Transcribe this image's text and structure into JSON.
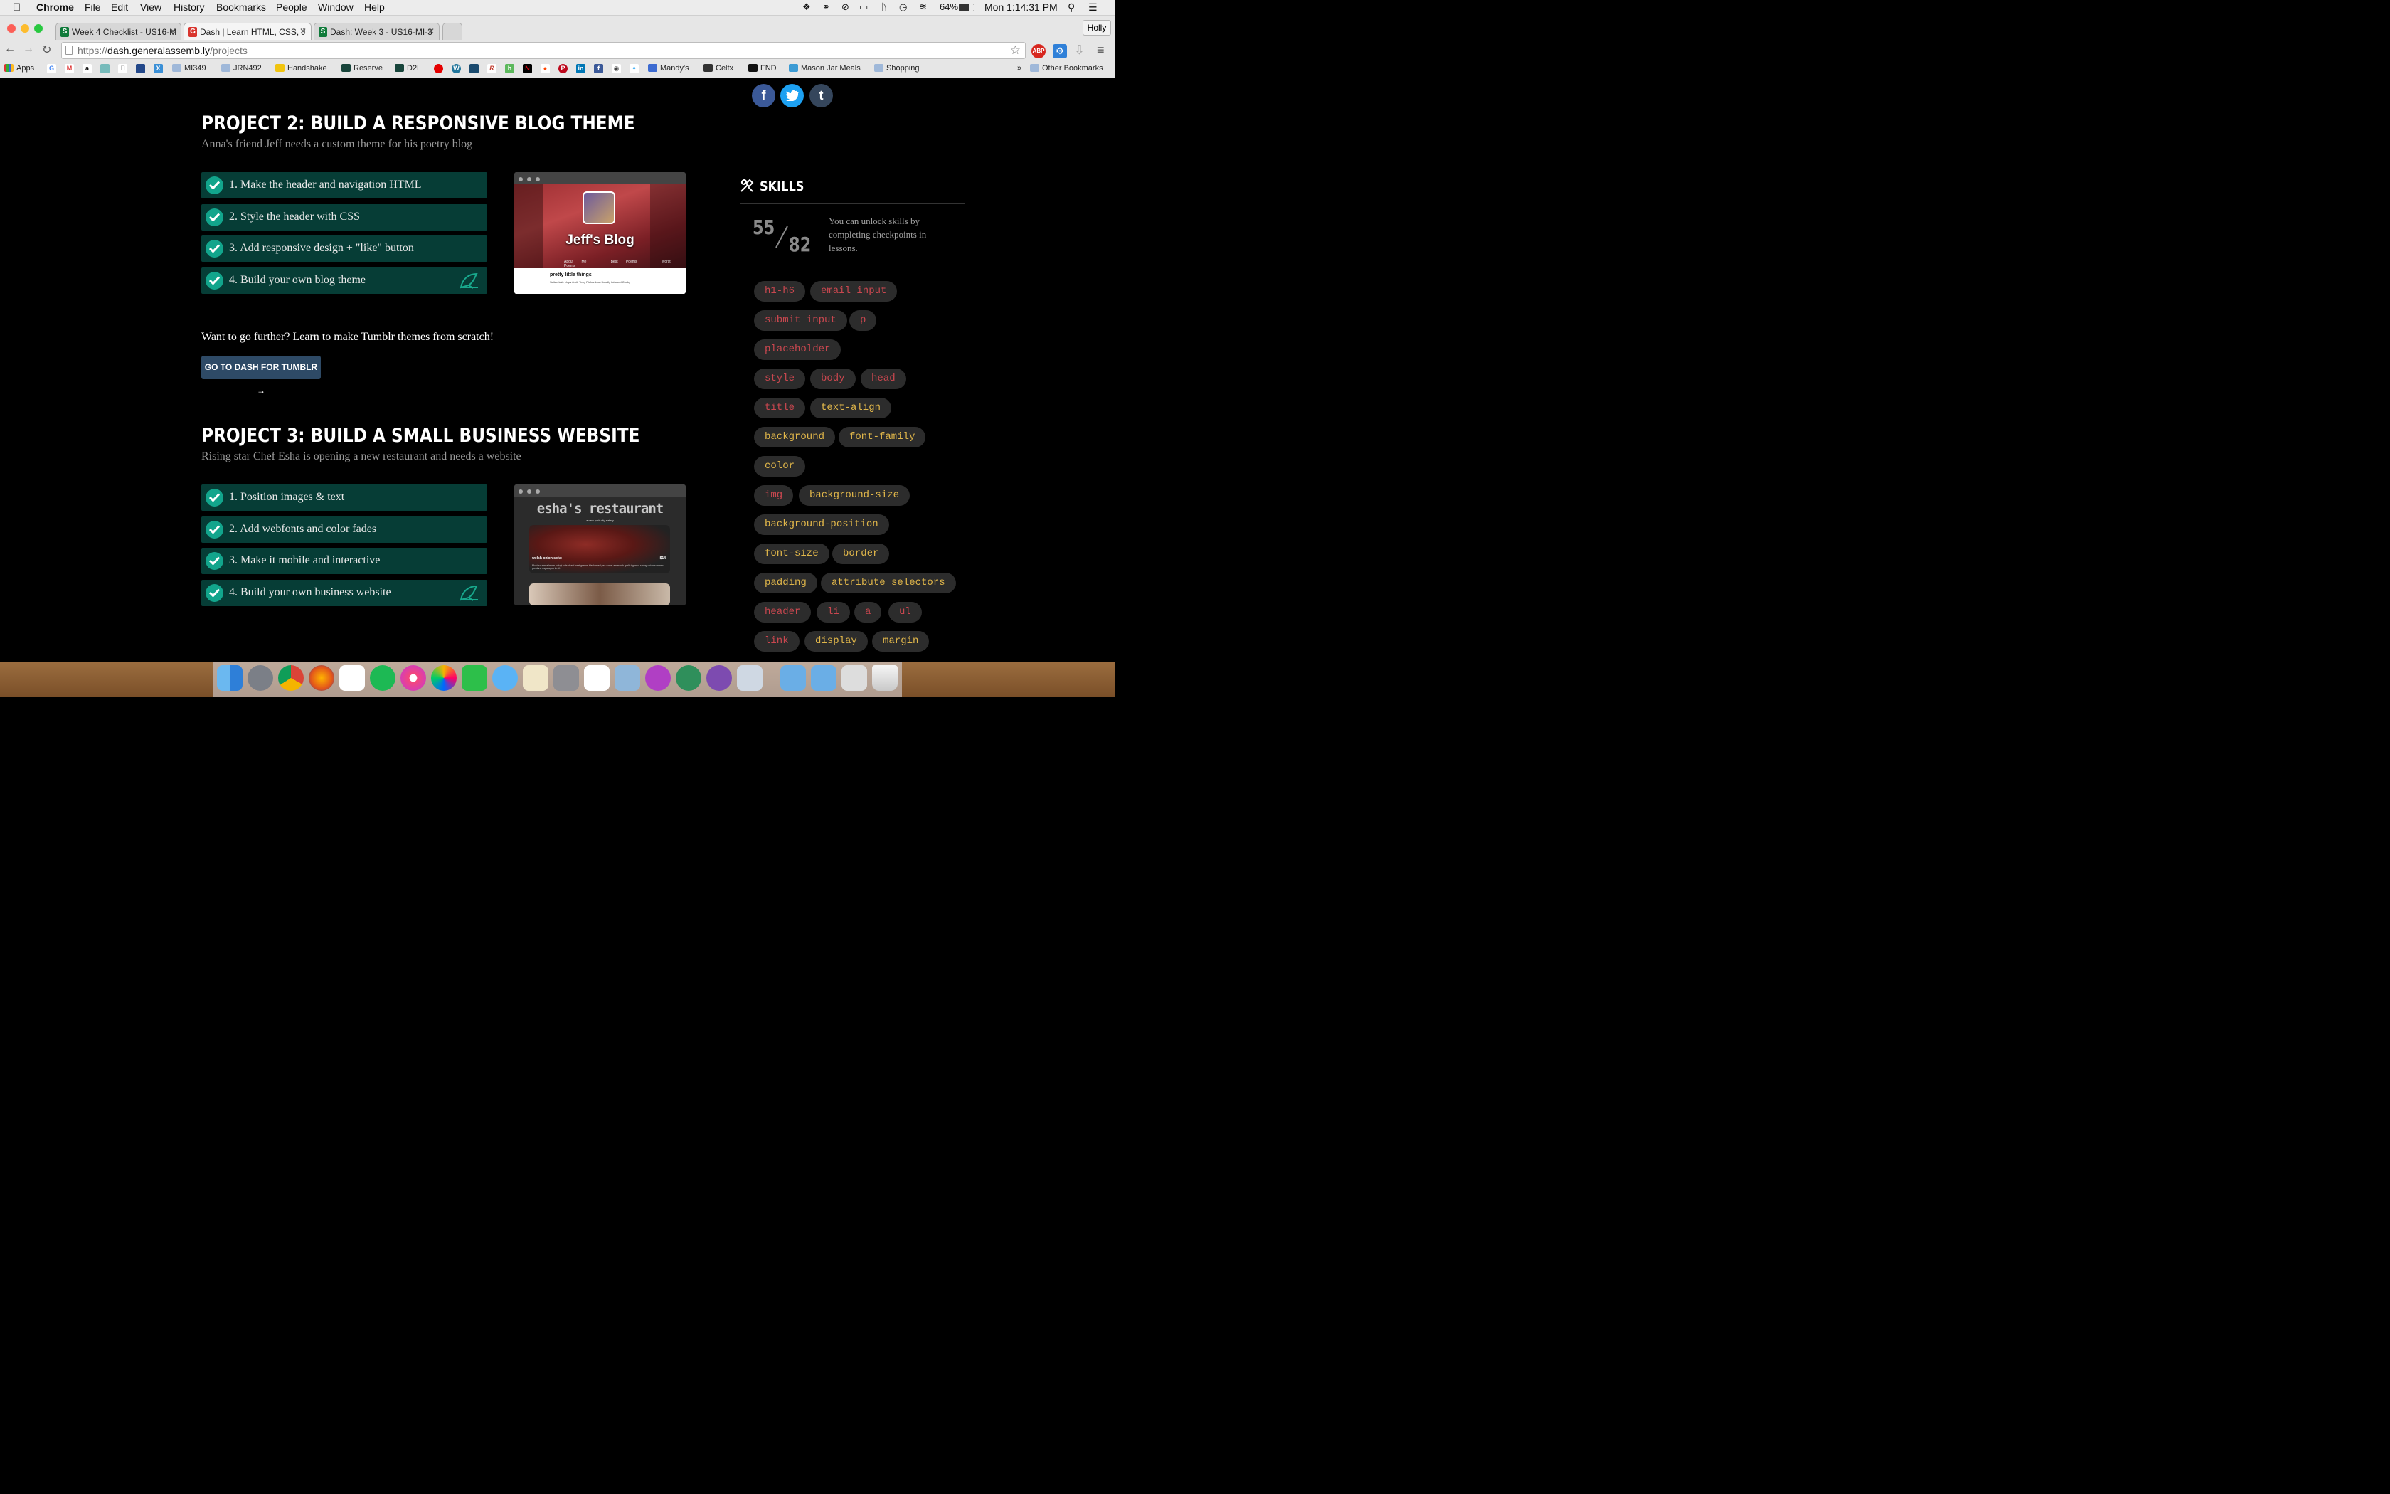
{
  "macbar": {
    "menus": [
      "Chrome",
      "File",
      "Edit",
      "View",
      "History",
      "Bookmarks",
      "People",
      "Window",
      "Help"
    ],
    "battery": "64%",
    "clock": "Mon 1:14:31 PM"
  },
  "browser": {
    "user": "Holly",
    "tabs": [
      {
        "title": "Week 4 Checklist - US16-M",
        "active": false
      },
      {
        "title": "Dash | Learn HTML, CSS, J",
        "active": true
      },
      {
        "title": "Dash: Week 3 - US16-MI-3",
        "active": false
      }
    ],
    "url_prefix": "https://",
    "url_host": "dash.generalassemb.ly",
    "url_path": "/projects",
    "bookmarks": [
      "Apps",
      "MI349",
      "JRN492",
      "Handshake",
      "Reserve",
      "D2L",
      "Mandy's",
      "Celtx",
      "FND",
      "Mason Jar Meals",
      "Shopping"
    ],
    "other_bookmarks": "Other Bookmarks"
  },
  "project2": {
    "title": "PROJECT 2: BUILD A RESPONSIVE BLOG THEME",
    "subtitle": "Anna's friend Jeff needs a custom theme for his poetry blog",
    "tasks": [
      "1. Make the header and navigation HTML",
      "2. Style the header with CSS",
      "3. Add responsive design + \"like\" button",
      "4. Build your own blog theme"
    ],
    "preview": {
      "heading": "Jeff's Blog",
      "nav": [
        "About Me",
        "Best Poems",
        "Worst Poems"
      ],
      "post_title": "pretty little things",
      "post_text": "Seitan kale chips 8-bit, Terry Richardson literally tattooed Cosby"
    }
  },
  "further": {
    "text": "Want to go further? Learn to make Tumblr themes from scratch!",
    "button": "GO TO DASH FOR TUMBLR →"
  },
  "project3": {
    "title": "PROJECT 3: BUILD A SMALL BUSINESS WEBSITE",
    "subtitle": "Rising star Chef Esha is opening a new restaurant and needs a website",
    "tasks": [
      "1. Position images & text",
      "2. Add webfonts and color fades",
      "3. Make it mobile and interactive",
      "4. Build your own business website"
    ],
    "preview": {
      "heading": "esha's restaurant",
      "tagline": "a new york city eatery",
      "dish": "welsh onion soko",
      "price": "$14",
      "desc": "Mustard sierra leone bologi kale chard beet greens black-eyed pea sorrel amaranth garlic tigernut spring onion summer purslane asparagus lentil."
    }
  },
  "social": [
    "f",
    "t",
    "t"
  ],
  "skills": {
    "heading": "SKILLS",
    "unlocked": "55",
    "total": "82",
    "note": "You can unlock skills by completing checkpoints in lessons.",
    "tags": [
      {
        "label": "h1-h6",
        "color": "#c9474f"
      },
      {
        "label": "email input",
        "color": "#c9474f"
      },
      {
        "label": "submit input",
        "color": "#c9474f"
      },
      {
        "label": "p",
        "color": "#c9474f"
      },
      {
        "label": "placeholder",
        "color": "#c9474f"
      },
      {
        "label": "style",
        "color": "#c9474f"
      },
      {
        "label": "body",
        "color": "#c9474f"
      },
      {
        "label": "head",
        "color": "#c9474f"
      },
      {
        "label": "title",
        "color": "#c9474f"
      },
      {
        "label": "text-align",
        "color": "#e0b64a"
      },
      {
        "label": "background",
        "color": "#e0b64a"
      },
      {
        "label": "font-family",
        "color": "#e0b64a"
      },
      {
        "label": "color",
        "color": "#e0b64a"
      },
      {
        "label": "img",
        "color": "#c9474f"
      },
      {
        "label": "background-size",
        "color": "#e0b64a"
      },
      {
        "label": "background-position",
        "color": "#e0b64a"
      },
      {
        "label": "font-size",
        "color": "#e0b64a"
      },
      {
        "label": "border",
        "color": "#e0b64a"
      },
      {
        "label": "padding",
        "color": "#e0b64a"
      },
      {
        "label": "attribute selectors",
        "color": "#e0b64a"
      },
      {
        "label": "header",
        "color": "#c9474f"
      },
      {
        "label": "li",
        "color": "#c9474f"
      },
      {
        "label": "a",
        "color": "#c9474f"
      },
      {
        "label": "ul",
        "color": "#c9474f"
      },
      {
        "label": "link",
        "color": "#c9474f"
      },
      {
        "label": "display",
        "color": "#e0b64a"
      },
      {
        "label": "margin",
        "color": "#e0b64a"
      }
    ]
  },
  "colors": {
    "task_bg": "#063d36",
    "check": "#12a58c",
    "tag_red": "#c9474f",
    "tag_yellow": "#e0b64a",
    "button": "#2e4a66"
  }
}
